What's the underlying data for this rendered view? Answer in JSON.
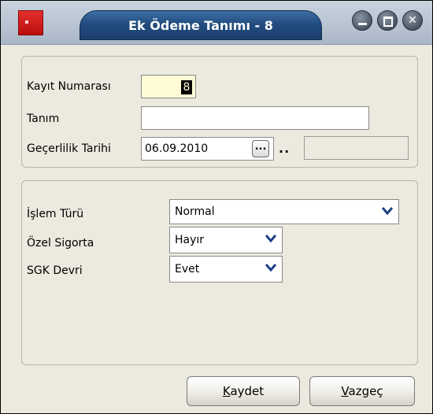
{
  "window": {
    "title": "Ek Ödeme Tanımı - 8",
    "controls": [
      "minimize-icon",
      "maximize-icon",
      "close-icon"
    ],
    "accent_color": "#224d80",
    "icon_color": "#d41f1c"
  },
  "general": {
    "record_no_label": "Kayıt Numarası",
    "record_no_value": "8",
    "definition_label": "Tanım",
    "definition_value": "",
    "validity_label": "Geçerlilik Tarihi",
    "validity_start": "06.09.2010",
    "lookup_button": "...",
    "range_separator": "..",
    "validity_end": ""
  },
  "details": {
    "transaction_type_label": "İşlem Türü",
    "transaction_type_value": "Normal",
    "private_insurance_label": "Özel Sigorta",
    "private_insurance_value": "Hayır",
    "sgk_transfer_label": "SGK Devri",
    "sgk_transfer_value": "Evet"
  },
  "footer": {
    "save_accel": "K",
    "save_rest": "aydet",
    "cancel_accel": "V",
    "cancel_rest": "azgeç"
  }
}
